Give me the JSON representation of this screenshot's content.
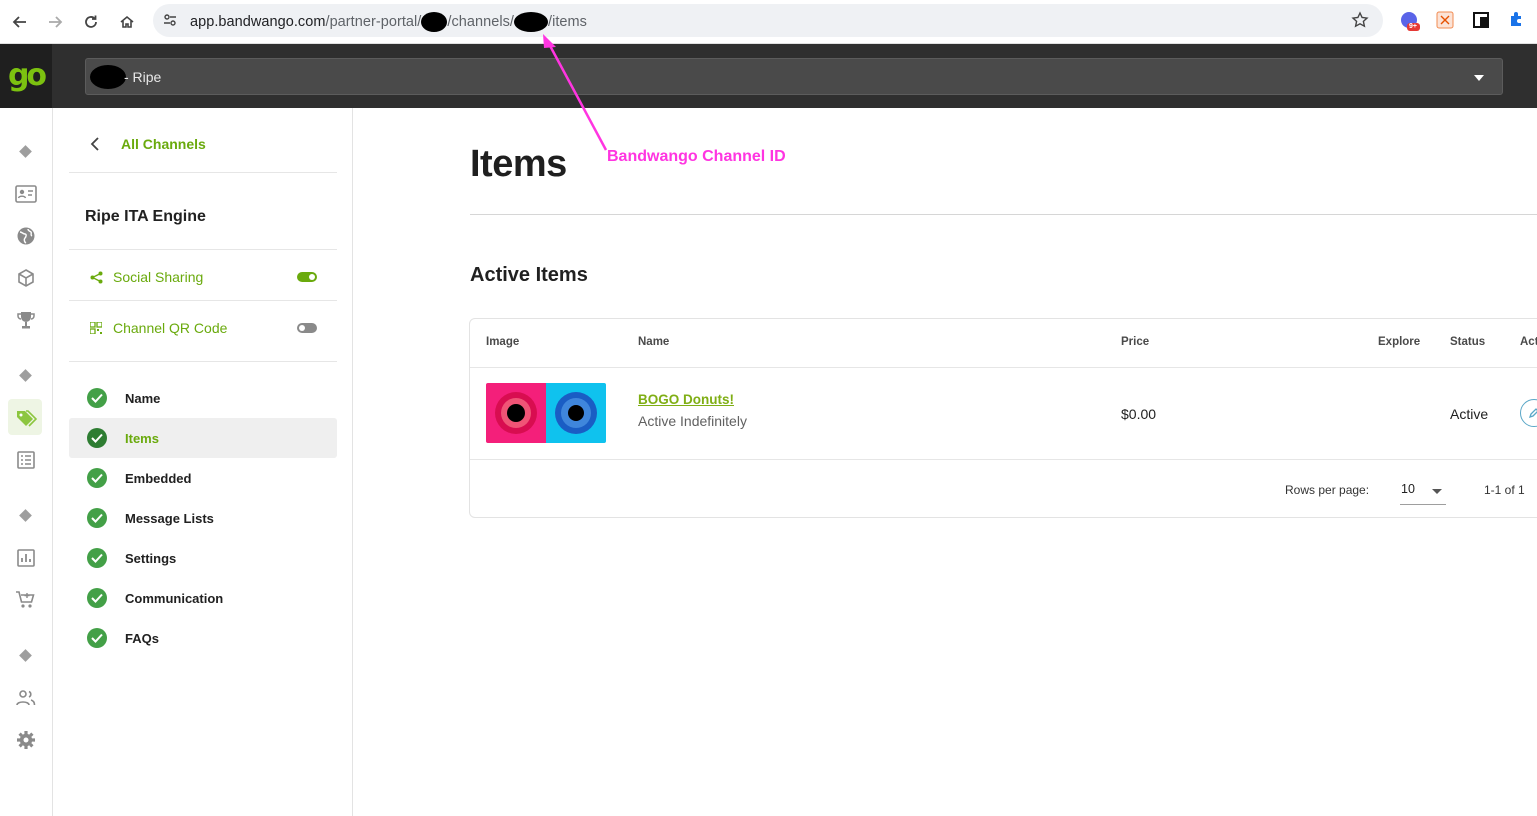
{
  "browser": {
    "url_domain": "app.bandwango.com",
    "url_part1": "/partner-portal/",
    "url_part2": "/channels/",
    "url_part3": "/items",
    "extension_badge": "9+"
  },
  "header": {
    "logo_text": "go",
    "org_name": "- Ripe"
  },
  "sidebar": {
    "back_label": "All Channels",
    "channel_name": "Ripe ITA Engine",
    "toggles": [
      {
        "label": "Social Sharing",
        "state": "on"
      },
      {
        "label": "Channel QR Code",
        "state": "off"
      }
    ],
    "steps": [
      {
        "label": "Name",
        "active": false
      },
      {
        "label": "Items",
        "active": true
      },
      {
        "label": "Embedded",
        "active": false
      },
      {
        "label": "Message Lists",
        "active": false
      },
      {
        "label": "Settings",
        "active": false
      },
      {
        "label": "Communication",
        "active": false
      },
      {
        "label": "FAQs",
        "active": false
      }
    ]
  },
  "main": {
    "title": "Items",
    "annotation": "Bandwango Channel ID",
    "section_title": "Active Items",
    "table": {
      "headers": [
        "Image",
        "Name",
        "Price",
        "Explore",
        "Status",
        "Act"
      ],
      "rows": [
        {
          "name": "BOGO Donuts!",
          "subtitle": "Active Indefinitely",
          "price": "$0.00",
          "status": "Active"
        }
      ]
    },
    "pagination": {
      "rows_per_page_label": "Rows per page:",
      "rows_per_page_value": "10",
      "range": "1-1 of 1"
    }
  },
  "colors": {
    "brand_green": "#6aaa0d",
    "check_green": "#43a047",
    "annotation_magenta": "#ff35e1",
    "header_dark": "#2f2f2f"
  }
}
